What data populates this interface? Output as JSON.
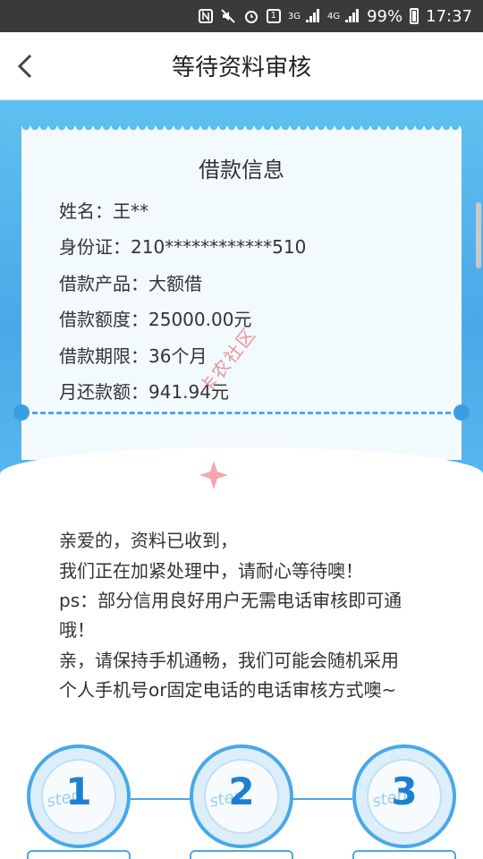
{
  "status_bar": {
    "network_small": "3G",
    "network_small2": "4G",
    "battery": "99%",
    "time": "17:37",
    "sim_badge": "1",
    "icons": [
      "nfc-icon",
      "mute-icon",
      "alarm-icon",
      "sim-icon",
      "signal-icon",
      "signal-icon",
      "battery-icon"
    ]
  },
  "nav": {
    "title": "等待资料审核",
    "back_icon": "chevron-left-icon"
  },
  "ticket": {
    "title": "借款信息",
    "rows": [
      "姓名：王**",
      "身份证：210************510",
      "借款产品：大额借",
      "借款额度：25000.00元",
      "借款期限：36个月",
      "月还款额：941.94元"
    ]
  },
  "watermark": {
    "text": "卡农社区"
  },
  "message": {
    "lines": [
      "亲爱的，资料已收到，",
      "我们正在加紧处理中，请耐心等待噢！",
      "ps：部分信用良好用户无需电话审核即可通",
      "哦！",
      "亲，请保持手机通畅，我们可能会随机采用",
      "个人手机号or固定电话的电话审核方式噢~"
    ]
  },
  "steps": [
    {
      "number": "1",
      "word": "step"
    },
    {
      "number": "2",
      "word": "step"
    },
    {
      "number": "3",
      "word": "step"
    }
  ],
  "colors": {
    "accent": "#4aa8e8",
    "header_bg": "#5fc1f0",
    "step_number": "#1e7fd0",
    "watermark": "#e63c50"
  }
}
